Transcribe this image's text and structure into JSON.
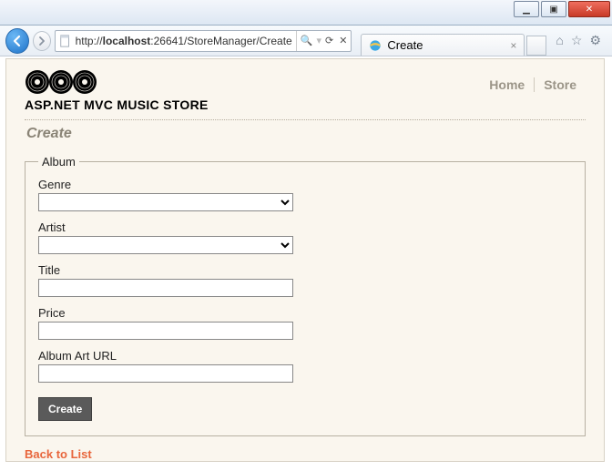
{
  "window": {
    "url_prefix": "http://",
    "url_host": "localhost",
    "url_port_path": ":26641/StoreManager/Create",
    "search_hint": "",
    "refresh_glyph": "⟳",
    "stop_glyph": "✕",
    "tab_title": "Create",
    "min_glyph": "▁",
    "max_glyph": "▣",
    "close_glyph": "✕",
    "home_glyph": "⌂",
    "star_glyph": "☆",
    "gear_glyph": "⚙"
  },
  "site": {
    "title": "ASP.NET MVC MUSIC STORE",
    "nav_home": "Home",
    "nav_store": "Store"
  },
  "page": {
    "heading": "Create",
    "fieldset_legend": "Album",
    "labels": {
      "genre": "Genre",
      "artist": "Artist",
      "title": "Title",
      "price": "Price",
      "art_url": "Album Art URL"
    },
    "values": {
      "genre": "",
      "artist": "",
      "title": "",
      "price": "",
      "art_url": ""
    },
    "submit_label": "Create",
    "back_link": "Back to List"
  }
}
